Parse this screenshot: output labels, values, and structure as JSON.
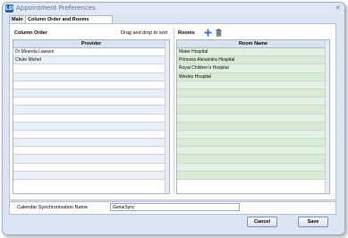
{
  "window": {
    "title": "Appointment Preferences",
    "app_icon_glyph": "LD",
    "close_glyph": "✕"
  },
  "tabs": [
    {
      "label": "Main",
      "active": false
    },
    {
      "label": "Column Order and Rooms",
      "active": true
    }
  ],
  "column_order": {
    "title": "Column Order",
    "hint": "Drag and drop to sort",
    "header": "Provider",
    "rows": [
      "Dr Miranda Lawson",
      "Chole Michel",
      "",
      "",
      "",
      "",
      "",
      "",
      "",
      "",
      "",
      "",
      "",
      "",
      "",
      ""
    ]
  },
  "rooms": {
    "title": "Rooms",
    "add_icon": "plus-icon",
    "delete_icon": "trash-icon",
    "header": "Room Name",
    "rows": [
      "Mater Hospital",
      "Princess Alexandra Hospital",
      "Royal Children's Hospital",
      "Wesley Hospital",
      "",
      "",
      "",
      "",
      "",
      "",
      "",
      "",
      "",
      "",
      "",
      ""
    ]
  },
  "sync": {
    "label": "Calendar Synchronisation Name",
    "value": "GenieSync"
  },
  "buttons": {
    "cancel": "Cancel",
    "save": "Save"
  },
  "colors": {
    "accent": "#1f5bb8",
    "room_row": "#e3f1df",
    "provider_row_alt": "#ebf0f8"
  }
}
